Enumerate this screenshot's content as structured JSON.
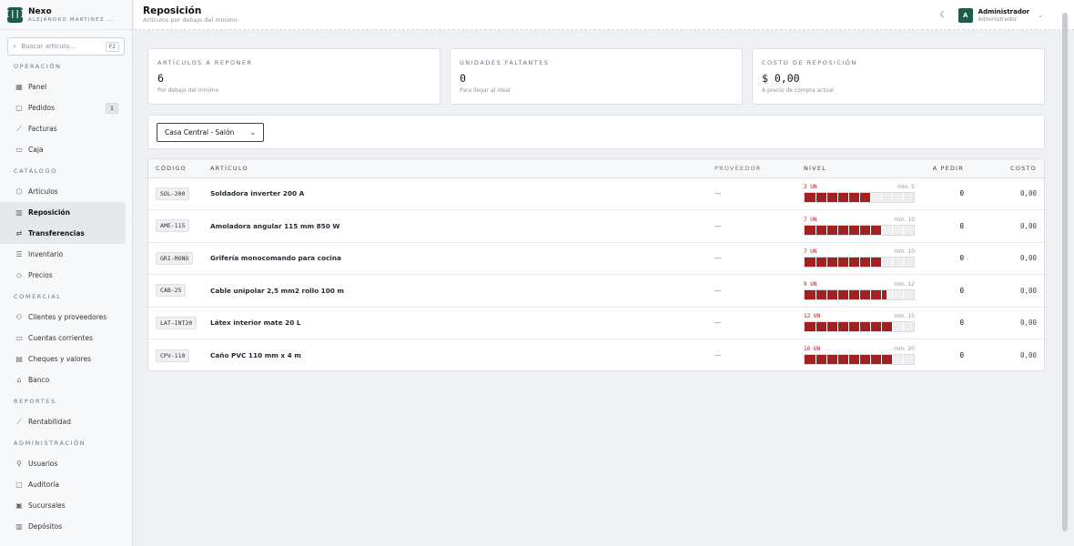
{
  "brand": {
    "logo": "[||]",
    "name": "Nexo",
    "company": "ALEJANDRO MARTINEZ ..."
  },
  "sidebar": {
    "search": {
      "placeholder": "Buscar artículo...",
      "shortcut": "F2"
    },
    "sections": [
      {
        "title": "OPERACIÓN",
        "items": [
          {
            "label": "Panel",
            "icon": "grid-icon",
            "glyph": "▦"
          },
          {
            "label": "Pedidos",
            "icon": "clipboard-icon",
            "glyph": "▢",
            "badge": "1"
          },
          {
            "label": "Facturas",
            "icon": "chart-line-icon",
            "glyph": "⟋"
          },
          {
            "label": "Caja",
            "icon": "register-icon",
            "glyph": "▭"
          }
        ]
      },
      {
        "title": "CATÁLOGO",
        "items": [
          {
            "label": "Artículos",
            "icon": "box-icon",
            "glyph": "⬡"
          },
          {
            "label": "Reposición",
            "icon": "bar-chart-icon",
            "glyph": "▥",
            "active": true
          },
          {
            "label": "Transferencias",
            "icon": "transfer-icon",
            "glyph": "⇄",
            "active": true
          },
          {
            "label": "Inventario",
            "icon": "list-icon",
            "glyph": "☰"
          },
          {
            "label": "Precios",
            "icon": "tag-icon",
            "glyph": "◇"
          }
        ]
      },
      {
        "title": "COMERCIAL",
        "items": [
          {
            "label": "Clientes y proveedores",
            "icon": "users-icon",
            "glyph": "⚇"
          },
          {
            "label": "Cuentas corrientes",
            "icon": "card-icon",
            "glyph": "▭"
          },
          {
            "label": "Cheques y valores",
            "icon": "check-icon",
            "glyph": "▤"
          },
          {
            "label": "Banco",
            "icon": "bank-icon",
            "glyph": "⌂"
          }
        ]
      },
      {
        "title": "REPORTES",
        "items": [
          {
            "label": "Rentabilidad",
            "icon": "trend-icon",
            "glyph": "⟋"
          }
        ]
      },
      {
        "title": "ADMINISTRACIÓN",
        "items": [
          {
            "label": "Usuarios",
            "icon": "user-icon",
            "glyph": "⚲"
          },
          {
            "label": "Auditoría",
            "icon": "document-icon",
            "glyph": "▢"
          },
          {
            "label": "Sucursales",
            "icon": "store-icon",
            "glyph": "▣"
          },
          {
            "label": "Depósitos",
            "icon": "warehouse-icon",
            "glyph": "▥"
          }
        ]
      }
    ]
  },
  "header": {
    "title": "Reposición",
    "subtitle": "Artículos por debajo del mínimo",
    "user": {
      "initial": "A",
      "name": "Administrador",
      "role": "Administrador"
    }
  },
  "stats": [
    {
      "label": "ARTÍCULOS A REPONER",
      "value": "6",
      "sub": "Por debajo del mínimo"
    },
    {
      "label": "UNIDADES FALTANTES",
      "value": "0",
      "sub": "Para llegar al ideal"
    },
    {
      "label": "COSTO DE REPOSICIÓN",
      "value": "$ 0,00",
      "sub": "A precio de compra actual"
    }
  ],
  "filter": {
    "branch": "Casa Central - Salón"
  },
  "table": {
    "headers": {
      "code": "CÓDIGO",
      "article": "ARTÍCULO",
      "supplier": "PROVEEDOR",
      "level": "NIVEL",
      "to_order": "A PEDIR",
      "cost": "COSTO"
    },
    "rows": [
      {
        "code": "SOL-200",
        "article": "Soldadora inverter 200 A",
        "supplier": "—",
        "level_text": "3 UN",
        "min_text": "min. 5",
        "level_fraction": 0.6,
        "to_order": "0",
        "cost": "0,00"
      },
      {
        "code": "AME-115",
        "article": "Amoladora angular 115 mm 850 W",
        "supplier": "—",
        "level_text": "7 UN",
        "min_text": "min. 10",
        "level_fraction": 0.7,
        "to_order": "0",
        "cost": "0,00"
      },
      {
        "code": "GRI-MONO",
        "article": "Grifería monocomando para cocina",
        "supplier": "—",
        "level_text": "7 UN",
        "min_text": "min. 10",
        "level_fraction": 0.7,
        "to_order": "0",
        "cost": "0,00"
      },
      {
        "code": "CAB-25",
        "article": "Cable unipolar 2,5 mm2 rollo 100 m",
        "supplier": "—",
        "level_text": "9 UN",
        "min_text": "min. 12",
        "level_fraction": 0.75,
        "to_order": "0",
        "cost": "0,00"
      },
      {
        "code": "LAT-INT20",
        "article": "Látex interior mate 20 L",
        "supplier": "—",
        "level_text": "12 UN",
        "min_text": "min. 15",
        "level_fraction": 0.8,
        "to_order": "0",
        "cost": "0,00"
      },
      {
        "code": "CPV-110",
        "article": "Caño PVC 110 mm x 4 m",
        "supplier": "—",
        "level_text": "16 UN",
        "min_text": "min. 20",
        "level_fraction": 0.8,
        "to_order": "0",
        "cost": "0,00"
      }
    ]
  }
}
